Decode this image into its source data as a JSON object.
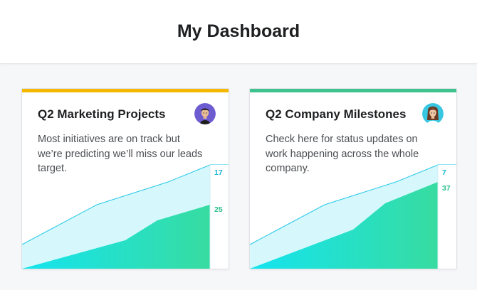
{
  "header": {
    "title": "My Dashboard"
  },
  "cards": [
    {
      "title": "Q2 Marketing Projects",
      "description": "Most initiatives are on track but we’re predicting we’ll miss our leads target.",
      "accent_color": "#f5b800",
      "avatar_icon": "person-avatar-dark-hair",
      "series_values": {
        "planned": "17",
        "completed": "25"
      }
    },
    {
      "title": "Q2 Company Milestones",
      "description": "Check here for status updates on work happening across the whole company.",
      "accent_color": "#3ec28f",
      "avatar_icon": "person-avatar-long-hair",
      "series_values": {
        "planned": "7",
        "completed": "37"
      }
    }
  ],
  "colors": {
    "planned_line": "#25c8e8",
    "planned_fill": "#d6f8fc",
    "completed_fill_start": "#14e4f0",
    "completed_fill_end": "#37dca0",
    "planned_label": "#1fb6d6",
    "completed_label": "#2bbf8c"
  }
}
